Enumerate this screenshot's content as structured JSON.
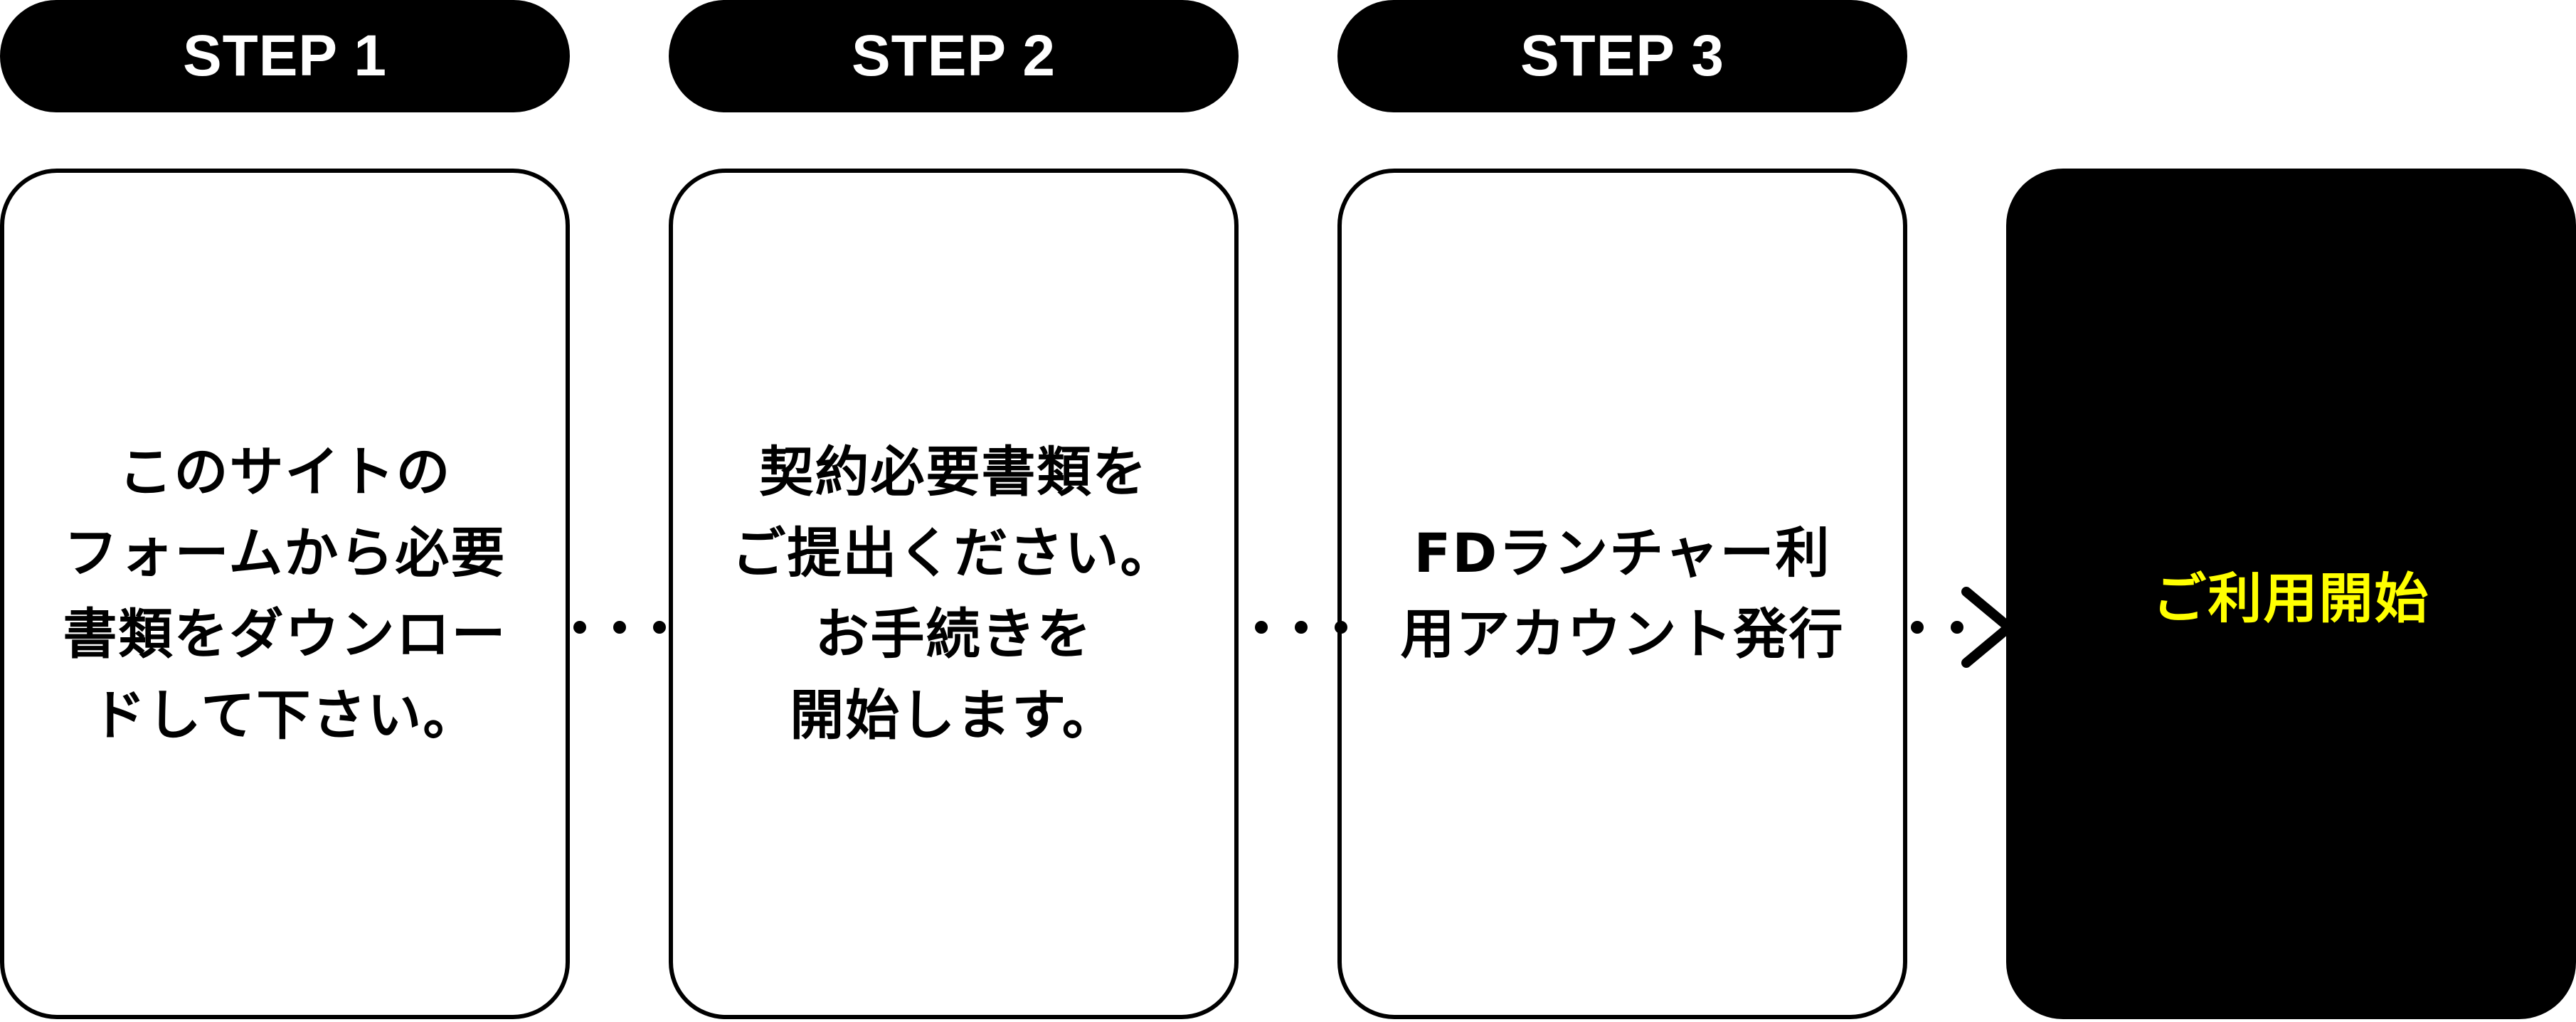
{
  "steps": [
    {
      "label": "STEP 1",
      "text": "このサイトの\nフォームから必要\n書類をダウンロー\nドして下さい。"
    },
    {
      "label": "STEP 2",
      "text": "契約必要書類を\nご提出ください。\nお手続きを\n開始します。"
    },
    {
      "label": "STEP 3",
      "text": "FDランチャー利\n用アカウント発行"
    }
  ],
  "final": {
    "text": "ご利用開始"
  },
  "colors": {
    "pill_bg": "#000000",
    "pill_text": "#ffffff",
    "card_border": "#000000",
    "final_bg": "#000000",
    "final_text": "#ffff00"
  },
  "icons": {
    "connector": "dotted-line",
    "final_connector": "chevron-right-icon"
  }
}
